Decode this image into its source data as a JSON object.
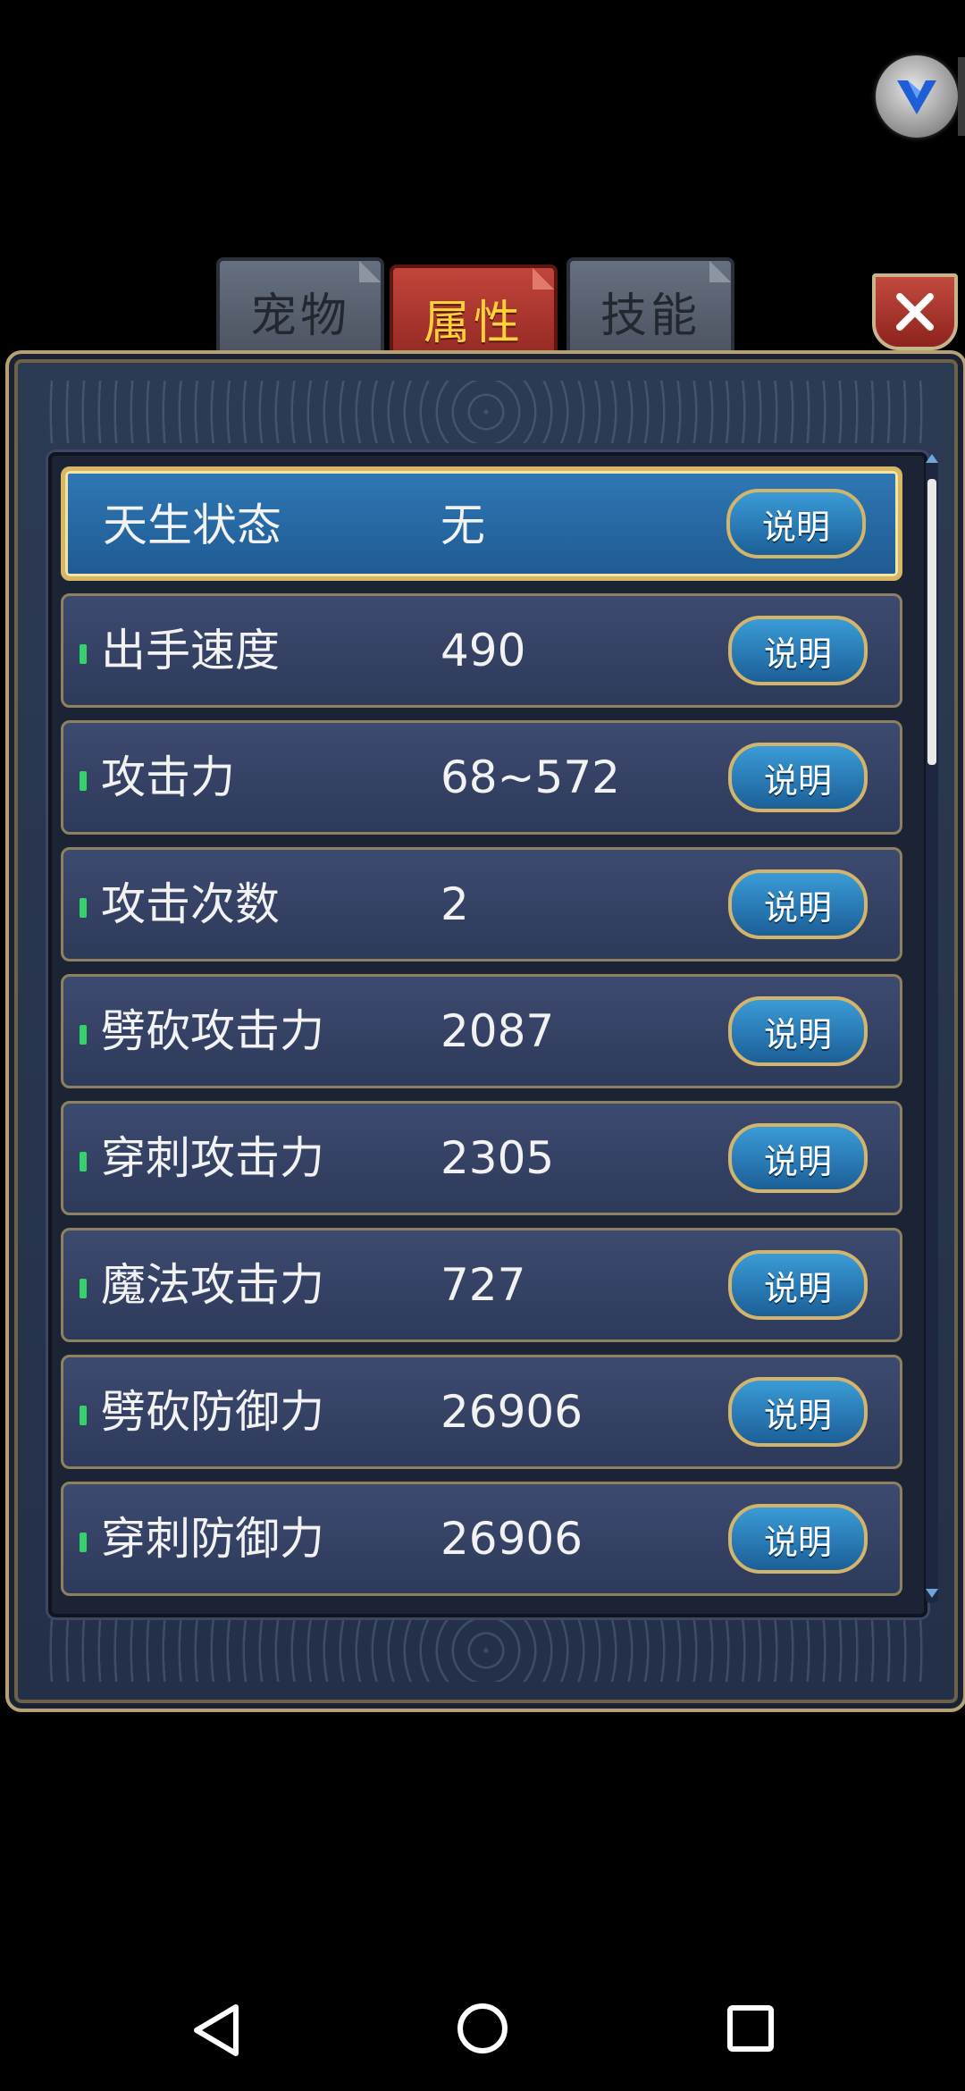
{
  "tabs": [
    {
      "label": "宠物",
      "active": false
    },
    {
      "label": "属性",
      "active": true
    },
    {
      "label": "技能",
      "active": false
    }
  ],
  "attributes": [
    {
      "label": "天生状态",
      "value": "无",
      "selected": true
    },
    {
      "label": "出手速度",
      "value": "490"
    },
    {
      "label": "攻击力",
      "value": "68~572"
    },
    {
      "label": "攻击次数",
      "value": "2"
    },
    {
      "label": "劈砍攻击力",
      "value": "2087"
    },
    {
      "label": "穿刺攻击力",
      "value": "2305"
    },
    {
      "label": "魔法攻击力",
      "value": "727"
    },
    {
      "label": "劈砍防御力",
      "value": "26906"
    },
    {
      "label": "穿刺防御力",
      "value": "26906"
    }
  ],
  "info_button_label": "说明",
  "colors": {
    "active_tab": "#c2453b",
    "active_tab_text": "#ffd23c",
    "selected_row": "#2f78b5",
    "row": "#3d4a70",
    "frame_gold": "#d8b764",
    "marker_green": "#34d36a"
  },
  "icons": {
    "close": "close-icon",
    "assistant": "assistant-v-icon",
    "nav_back": "back-triangle-icon",
    "nav_home": "home-circle-icon",
    "nav_recents": "recents-square-icon"
  }
}
